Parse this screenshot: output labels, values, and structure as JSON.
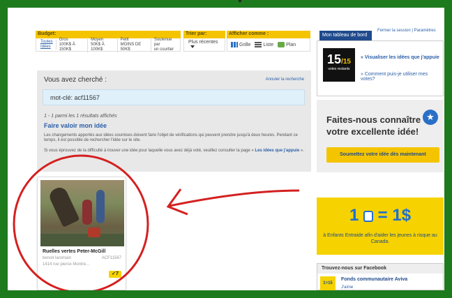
{
  "filters": {
    "budget": {
      "label": "Budget:",
      "options": [
        {
          "line1": "Toutes",
          "line2": "Idées"
        },
        {
          "line1": "Gros",
          "line2": "100K$ À 150K$"
        },
        {
          "line1": "Moyen",
          "line2": "50K$ À 100K$"
        },
        {
          "line1": "Petit",
          "line2": "MOINS DE 50K$"
        },
        {
          "line1": "Soutenue par",
          "line2": "un courtier"
        }
      ]
    },
    "sort": {
      "label": "Trier par:",
      "value": "Plus récentes"
    },
    "view": {
      "label": "Afficher comme :",
      "options": [
        "Grille",
        "Liste",
        "Plan"
      ]
    }
  },
  "search": {
    "title": "Vous avez cherché :",
    "cancel": "Annuler la recherche",
    "keyword": "mot-clé: acf11567",
    "count": "1 - 1 parmi les 1 résultats affichés",
    "link": "Faire valoir mon idée",
    "para1": "Les changements apportés aux idées soumises doivent faire l'objet de vérifications qui peuvent prendre jusqu'à deux heures. Pendant ce temps, il est possible de rechercher l'idée sur le site.",
    "para2": "Si vous éprouvez de la difficulté à trouver une idée pour laquelle vous avez déjà voté, veuillez consulter la page «",
    "para2_link": "Les idées que j'appuie",
    "para2_end": "»."
  },
  "card": {
    "title": "Ruelles vertes Peter-McGill",
    "author": "benoit laromain",
    "code": "ACF11567",
    "address": "1414 rue pierce Montre...",
    "votes": "7"
  },
  "sidebar": {
    "tab": "Mon tableau de bord",
    "links": "Fermer la session | Paramètres",
    "votes_num": "15",
    "votes_den": "/15",
    "votes_label": "votes restants",
    "link1": "» Visualiser les idées que j'appuie",
    "link2": "» Comment puis-je utiliser mes votes?",
    "share_title": "Faites-nous connaître votre excellente idée!",
    "share_button": "Soumettez votre idée dès maintenant",
    "promo_left": "1",
    "promo_right": "= 1$",
    "promo_text": "à Enfants Entraide afin d'aider les jeunes à risque au Canada.",
    "fb_header": "Trouvez-nous sur Facebook",
    "fb_name": "Fonds communautaire Aviva",
    "fb_like": "J'aime",
    "fb_logo": "1=15"
  },
  "colors": {
    "accent": "#f5c400",
    "frame": "#1d7a1d",
    "annotation": "#d42020",
    "link": "#2a5ea8"
  }
}
